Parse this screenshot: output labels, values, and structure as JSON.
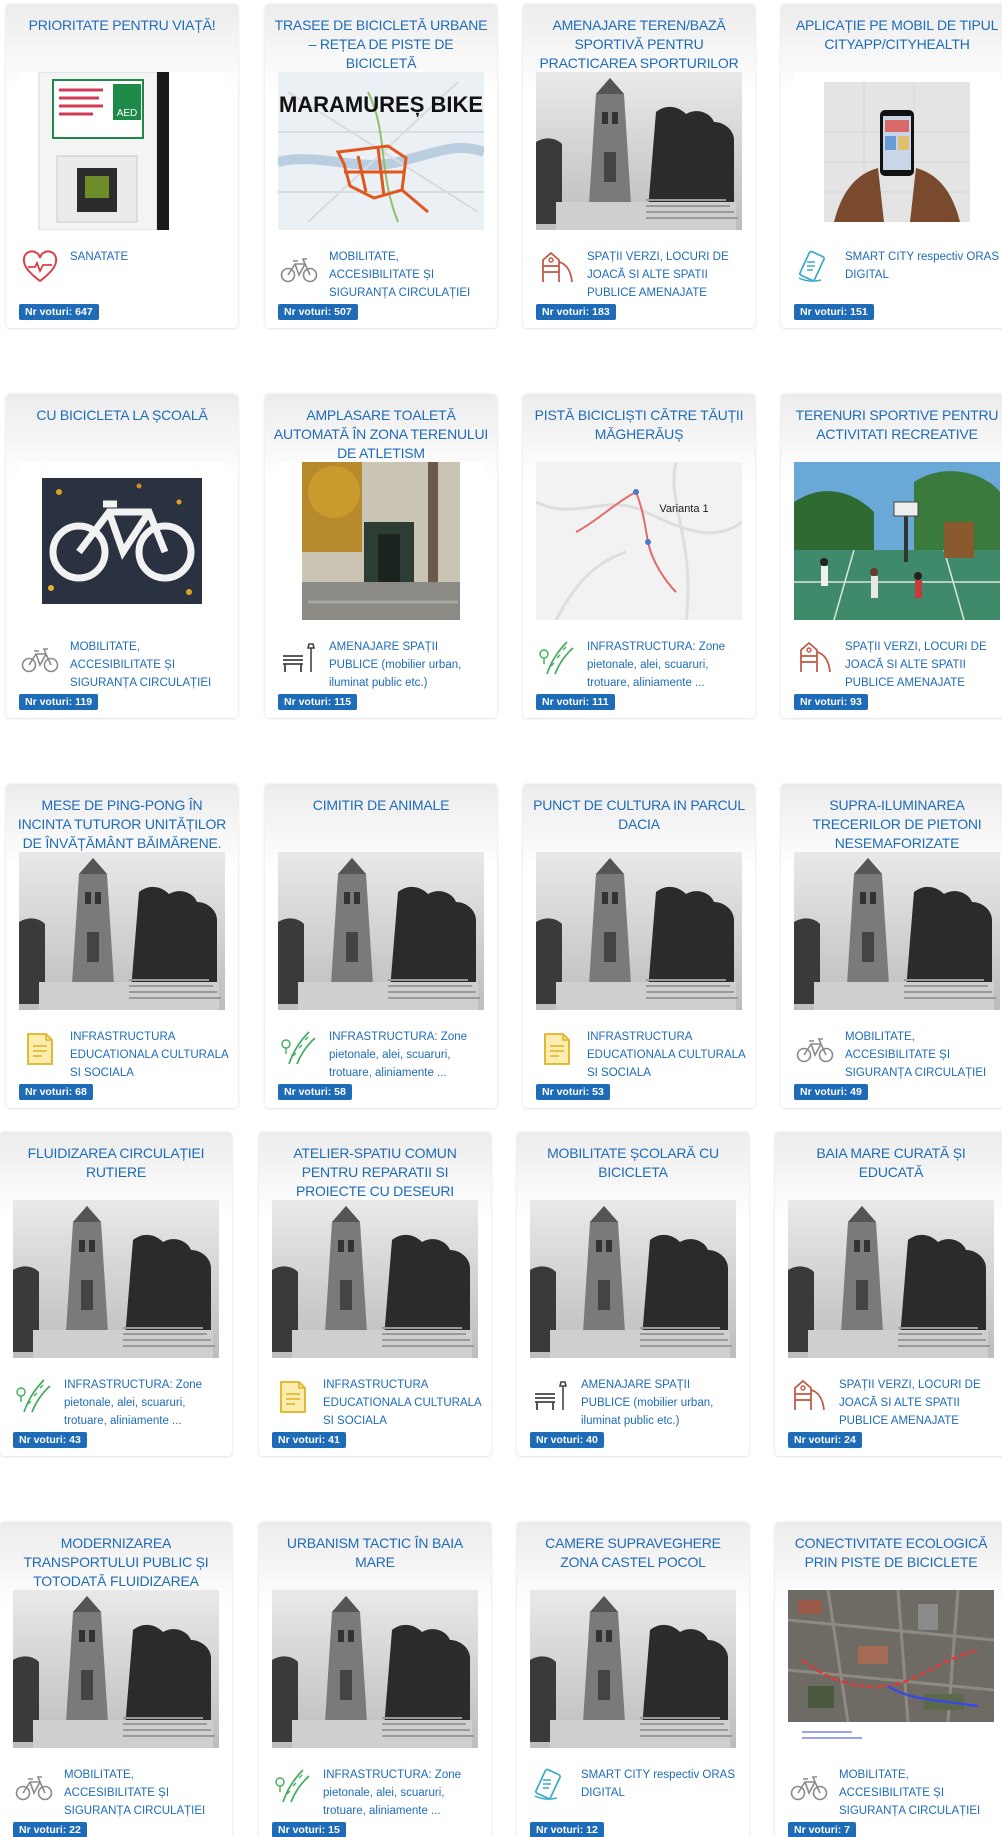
{
  "colors": {
    "title": "#1e6bb8",
    "badge": "#1e6bb8",
    "header_gradient": "#ececec"
  },
  "cards": [
    {
      "title": "PRIORITATE PENTRU VIAȚĂ!",
      "image": "aed-defibrillator-photo",
      "icon": "heart-pulse-icon",
      "category": "SANATATE",
      "votes": "Nr voturi: 647"
    },
    {
      "title": "TRASEE DE BICICLETĂ URBANE – REȚEA DE PISTE DE BICICLETĂ",
      "image": "bike-route-map",
      "image_text": "MARAMUREȘ BIKE",
      "icon": "bicycle-icon",
      "category": "MOBILITATE, ACCESIBILITATE ȘI SIGURANȚA CIRCULAȚIEI",
      "votes": "Nr voturi: 507"
    },
    {
      "title": "AMENAJARE TEREN/BAZĂ SPORTIVĂ PENTRU PRACTICAREA SPORTURILOR PE NISIP: BEACH",
      "image": "tower-photo",
      "icon": "playground-icon",
      "category": "SPAȚII VERZI, LOCURI DE JOACĂ SI ALTE SPATII PUBLICE AMENAJATE",
      "votes": "Nr voturi: 183"
    },
    {
      "title": "APLICAȚIE PE MOBIL DE TIPUL CITYAPP/CITYHEALTH",
      "image": "phone-hands-photo",
      "icon": "smart-city-icon",
      "category": "SMART CITY respectiv ORAS DIGITAL",
      "votes": "Nr voturi: 151"
    },
    {
      "title": "CU BICICLETA LA ȘCOALĂ",
      "image": "bike-lane-photo",
      "icon": "bicycle-icon",
      "category": "MOBILITATE, ACCESIBILITATE ȘI SIGURANȚA CIRCULAȚIEI",
      "votes": "Nr voturi: 119"
    },
    {
      "title": "AMPLASARE TOALETĂ AUTOMATĂ ÎN ZONA TERENULUI DE ATLETISM",
      "image": "toilet-kiosk-photo",
      "icon": "bench-lamp-icon",
      "category": "AMENAJARE SPAȚII PUBLICE (mobilier urban, iluminat public etc.)",
      "votes": "Nr voturi: 115"
    },
    {
      "title": "PISTĂ BICICLIȘTI CĂTRE TĂUȚII MĂGHERĂUȘ",
      "image": "route-map",
      "image_text": "Varianta 1",
      "icon": "road-trees-icon",
      "category": "INFRASTRUCTURA: Zone pietonale, alei, scuaruri, trotuare, aliniamente ...",
      "votes": "Nr voturi: 111"
    },
    {
      "title": "TERENURI SPORTIVE PENTRU ACTIVITATI RECREATIVE",
      "image": "basketball-court-photo",
      "icon": "playground-icon",
      "category": "SPAȚII VERZI, LOCURI DE JOACĂ SI ALTE SPATII PUBLICE AMENAJATE",
      "votes": "Nr voturi: 93"
    },
    {
      "title": "MESE DE PING-PONG ÎN INCINTA TUTUROR UNITĂȚILOR DE ÎNVĂȚĂMÂNT BĂIMĂRENE.",
      "image": "tower-photo",
      "icon": "book-building-icon",
      "category": "INFRASTRUCTURA EDUCATIONALA CULTURALA SI SOCIALA",
      "votes": "Nr voturi: 68"
    },
    {
      "title": "CIMITIR DE ANIMALE",
      "image": "tower-photo",
      "icon": "road-trees-icon",
      "category": "INFRASTRUCTURA: Zone pietonale, alei, scuaruri, trotuare, aliniamente ...",
      "votes": "Nr voturi: 58"
    },
    {
      "title": "PUNCT DE CULTURA IN PARCUL DACIA",
      "image": "tower-photo",
      "icon": "book-building-icon",
      "category": "INFRASTRUCTURA EDUCATIONALA CULTURALA SI SOCIALA",
      "votes": "Nr voturi: 53"
    },
    {
      "title": "SUPRA-ILUMINAREA TRECERILOR DE PIETONI NESEMAFORIZATE",
      "image": "tower-photo",
      "icon": "bicycle-icon",
      "category": "MOBILITATE, ACCESIBILITATE ȘI SIGURANȚA CIRCULAȚIEI",
      "votes": "Nr voturi: 49"
    },
    {
      "title": "FLUIDIZAREA CIRCULAȚIEI RUTIERE",
      "image": "tower-photo",
      "icon": "road-trees-icon",
      "category": "INFRASTRUCTURA: Zone pietonale, alei, scuaruri, trotuare, aliniamente ...",
      "votes": "Nr voturi: 43"
    },
    {
      "title": "ATELIER-SPATIU COMUN PENTRU REPARATII SI PROIECTE CU DESEURI REFOLOSIBILE",
      "image": "tower-photo",
      "icon": "book-building-icon",
      "category": "INFRASTRUCTURA EDUCATIONALA CULTURALA SI SOCIALA",
      "votes": "Nr voturi: 41"
    },
    {
      "title": "MOBILITATE ȘCOLARĂ CU BICICLETA",
      "image": "tower-photo",
      "icon": "bench-lamp-icon",
      "category": "AMENAJARE SPAȚII PUBLICE (mobilier urban, iluminat public etc.)",
      "votes": "Nr voturi: 40"
    },
    {
      "title": "BAIA MARE CURATĂ ȘI EDUCATĂ",
      "image": "tower-photo",
      "icon": "playground-icon",
      "category": "SPAȚII VERZI, LOCURI DE JOACĂ SI ALTE SPATII PUBLICE AMENAJATE",
      "votes": "Nr voturi: 24"
    },
    {
      "title": "MODERNIZAREA TRANSPORTULUI PUBLIC ȘI TOTODATĂ FLUIDIZAREA",
      "image": "tower-photo",
      "icon": "bicycle-icon",
      "category": "MOBILITATE, ACCESIBILITATE ȘI SIGURANȚA CIRCULAȚIEI",
      "votes": "Nr voturi: 22"
    },
    {
      "title": "URBANISM TACTIC ÎN BAIA MARE",
      "image": "tower-photo",
      "icon": "road-trees-icon",
      "category": "INFRASTRUCTURA: Zone pietonale, alei, scuaruri, trotuare, aliniamente ...",
      "votes": "Nr voturi: 15"
    },
    {
      "title": "CAMERE SUPRAVEGHERE ZONA CASTEL POCOL",
      "image": "tower-photo",
      "icon": "smart-city-icon",
      "category": "SMART CITY respectiv ORAS DIGITAL",
      "votes": "Nr voturi: 12"
    },
    {
      "title": "CONECTIVITATE ECOLOGICĂ PRIN PISTE DE BICICLETE",
      "image": "satellite-map-photo",
      "icon": "bicycle-icon",
      "category": "MOBILITATE, ACCESIBILITATE ȘI SIGURANȚA CIRCULAȚIEI",
      "votes": "Nr voturi: 7"
    }
  ]
}
